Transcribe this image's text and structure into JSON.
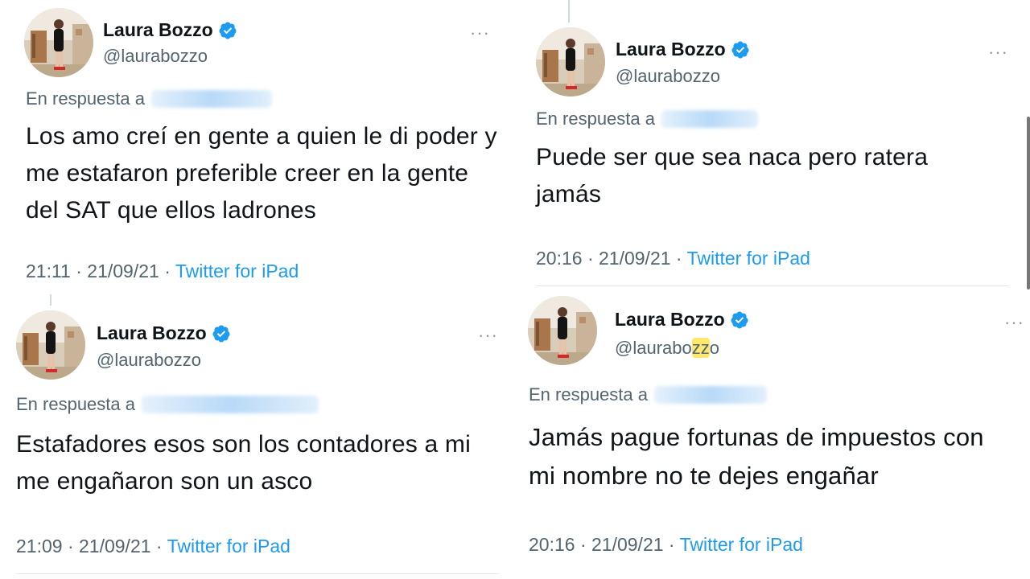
{
  "tweets": [
    {
      "name": "Laura Bozzo",
      "handle": "@laurabozzo",
      "reply_prefix": "En respuesta a",
      "text": "Los amo creí en gente a quien le di poder y me estafaron preferible creer en la gente del SAT que ellos ladrones",
      "time": "21:11 · 21/09/21 ·",
      "source": "Twitter for iPad",
      "more": "···"
    },
    {
      "name": "Laura Bozzo",
      "handle": "@laurabozzo",
      "reply_prefix": "En respuesta a",
      "text": "Puede ser que sea naca pero ratera jamás",
      "time": "20:16 · 21/09/21 ·",
      "source": "Twitter for iPad",
      "more": "···"
    },
    {
      "name": "Laura Bozzo",
      "handle": "@laurabozzo",
      "reply_prefix": "En respuesta a",
      "text": "Estafadores esos son los contadores a mi me engañaron son un asco",
      "time": "21:09 · 21/09/21 ·",
      "source": "Twitter for iPad",
      "more": "···"
    },
    {
      "name": "Laura Bozzo",
      "handle_start": "@laurabo",
      "handle_highlight": "zz",
      "handle_end": "o",
      "reply_prefix": "En respuesta a",
      "text": "Jamás pague fortunas de impuestos con mi nombre no te dejes engañar",
      "time": "20:16 · 21/09/21 ·",
      "source": "Twitter for iPad",
      "more": "···"
    }
  ],
  "colors": {
    "verified": "#1d9bf0",
    "link": "#1d9bf0",
    "secondary": "#536471",
    "highlight": "#ffe13c"
  },
  "icons": [
    "verified-badge-icon",
    "more-options-icon",
    "avatar-photo"
  ]
}
